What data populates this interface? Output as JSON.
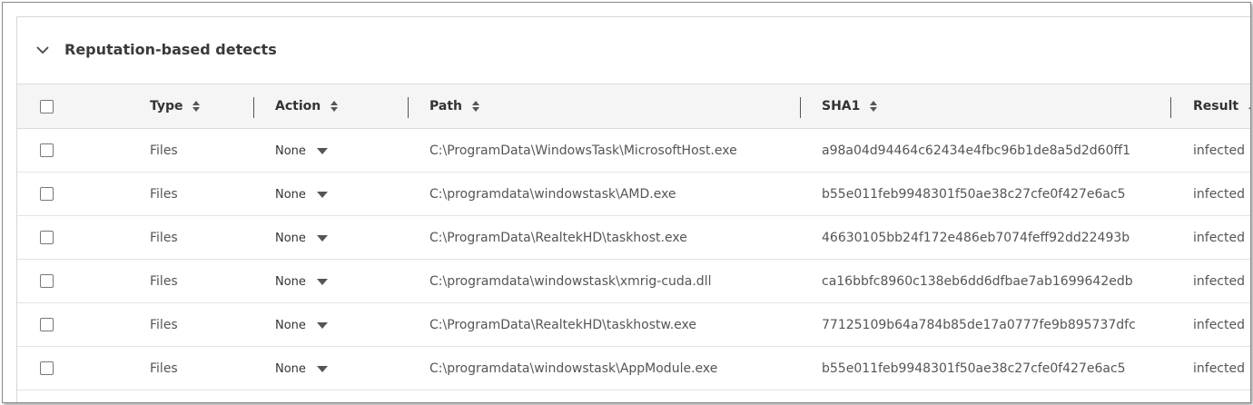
{
  "section": {
    "title": "Reputation-based detects"
  },
  "table": {
    "headers": {
      "type": "Type",
      "action": "Action",
      "path": "Path",
      "sha1": "SHA1",
      "result": "Result"
    },
    "rows": [
      {
        "type": "Files",
        "action": "None",
        "path": "C:\\ProgramData\\WindowsTask\\MicrosoftHost.exe",
        "sha1": "a98a04d94464c62434e4fbc96b1de8a5d2d60ff1",
        "result": "infected"
      },
      {
        "type": "Files",
        "action": "None",
        "path": "C:\\programdata\\windowstask\\AMD.exe",
        "sha1": "b55e011feb9948301f50ae38c27cfe0f427e6ac5",
        "result": "infected"
      },
      {
        "type": "Files",
        "action": "None",
        "path": "C:\\ProgramData\\RealtekHD\\taskhost.exe",
        "sha1": "46630105bb24f172e486eb7074feff92dd22493b",
        "result": "infected"
      },
      {
        "type": "Files",
        "action": "None",
        "path": "C:\\programdata\\windowstask\\xmrig-cuda.dll",
        "sha1": "ca16bbfc8960c138eb6dd6dfbae7ab1699642edb",
        "result": "infected"
      },
      {
        "type": "Files",
        "action": "None",
        "path": "C:\\ProgramData\\RealtekHD\\taskhostw.exe",
        "sha1": "77125109b64a784b85de17a0777fe9b895737dfc",
        "result": "infected"
      },
      {
        "type": "Files",
        "action": "None",
        "path": "C:\\programdata\\windowstask\\AppModule.exe",
        "sha1": "b55e011feb9948301f50ae38c27cfe0f427e6ac5",
        "result": "infected"
      }
    ]
  }
}
